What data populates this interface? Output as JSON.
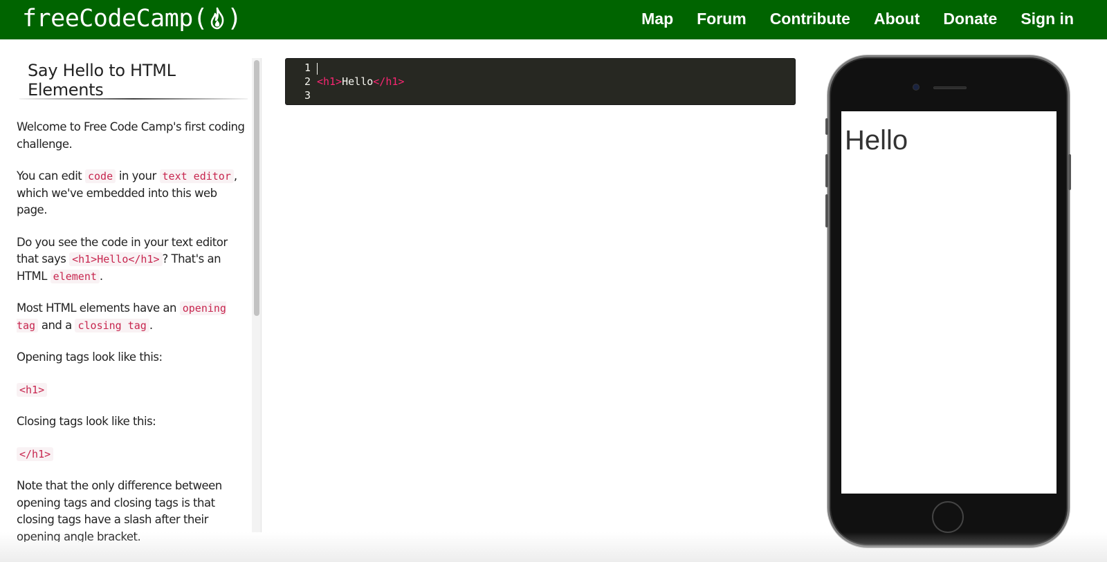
{
  "navbar": {
    "brand_left": "freeCodeCamp",
    "brand_paren_open": "(",
    "brand_paren_close": ")",
    "links": [
      "Map",
      "Forum",
      "Contribute",
      "About",
      "Donate",
      "Sign in"
    ],
    "background_color": "#006400"
  },
  "challenge": {
    "title": "Say Hello to HTML Elements",
    "paragraphs": {
      "p1": "Welcome to Free Code Camp's first coding challenge.",
      "p2_a": "You can edit ",
      "p2_code1": "code",
      "p2_b": " in your ",
      "p2_code2": "text editor",
      "p2_c": ", which we've embedded into this web page.",
      "p3_a": "Do you see the code in your text editor that says ",
      "p3_code1": "<h1>Hello</h1>",
      "p3_b": "? That's an HTML ",
      "p3_code2": "element",
      "p3_c": ".",
      "p4_a": "Most HTML elements have an ",
      "p4_code1": "opening tag",
      "p4_b": " and a ",
      "p4_code2": "closing tag",
      "p4_c": ".",
      "p5": "Opening tags look like this:",
      "p6_code": "<h1>",
      "p7": "Closing tags look like this:",
      "p8_code": "</h1>",
      "p9": "Note that the only difference between opening tags and closing tags is that closing tags have a slash after their opening angle bracket."
    }
  },
  "editor": {
    "line_numbers": [
      "1",
      "2",
      "3"
    ],
    "line2_open_tag": "<h1>",
    "line2_text": "Hello",
    "line2_close_tag": "</h1>",
    "background_color": "#272822",
    "tag_color": "#f92672"
  },
  "preview": {
    "heading": "Hello"
  },
  "icons": {
    "brand": "flame-icon"
  }
}
